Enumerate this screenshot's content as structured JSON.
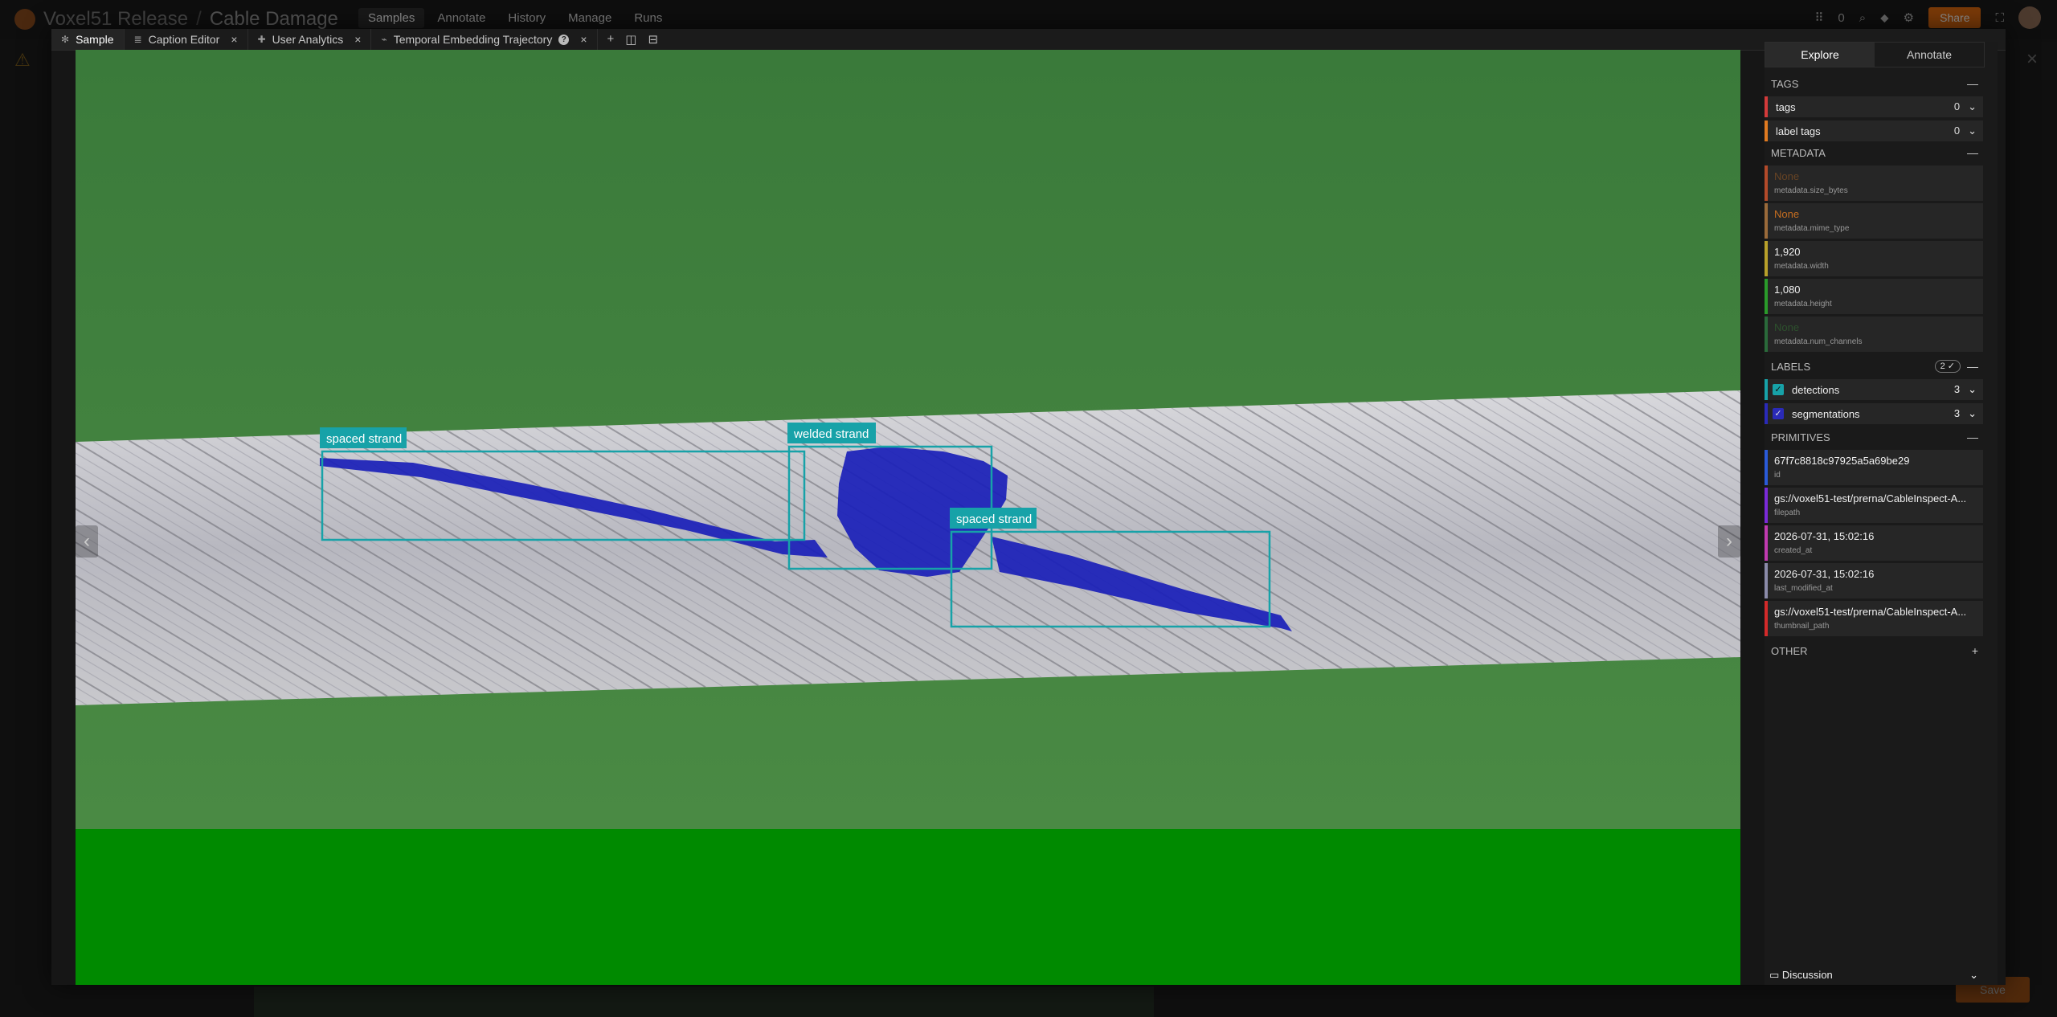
{
  "app": {
    "org": "Voxel51 Release",
    "dataset": "Cable Damage",
    "nav": [
      "Samples",
      "Annotate",
      "History",
      "Manage",
      "Runs"
    ],
    "active_nav": "Samples",
    "selected_count": "0",
    "share_label": "Share"
  },
  "modal": {
    "tabs": [
      {
        "label": "Sample",
        "closable": false,
        "active": true
      },
      {
        "label": "Caption Editor",
        "closable": true,
        "active": false
      },
      {
        "label": "User Analytics",
        "closable": true,
        "active": false
      },
      {
        "label": "Temporal Embedding Trajectory",
        "closable": true,
        "active": false,
        "help": true
      }
    ]
  },
  "viewer": {
    "detections": [
      {
        "label": "spaced strand",
        "color": "#17a2a8"
      },
      {
        "label": "welded strand",
        "color": "#17a2a8"
      },
      {
        "label": "spaced strand",
        "color": "#17a2a8"
      }
    ],
    "mask_color": "#1a20b8",
    "background_color": "#3d7f3d",
    "bottom_band_color": "#008a00"
  },
  "sidebar": {
    "tabs": [
      "Explore",
      "Annotate"
    ],
    "active_tab": "Explore",
    "tags_section": "TAGS",
    "tags": [
      {
        "label": "tags",
        "count": "0",
        "color": "#d33a3a"
      },
      {
        "label": "label tags",
        "count": "0",
        "color": "#e07a20"
      }
    ],
    "metadata_section": "METADATA",
    "metadata": [
      {
        "value": "None",
        "key": "metadata.size_bytes",
        "color": "#b34a2a",
        "style": "none-dim"
      },
      {
        "value": "None",
        "key": "metadata.mime_type",
        "color": "#9a6a3a",
        "style": "none"
      },
      {
        "value": "1,920",
        "key": "metadata.width",
        "color": "#b8a02a",
        "style": "value"
      },
      {
        "value": "1,080",
        "key": "metadata.height",
        "color": "#2a9a2a",
        "style": "value"
      },
      {
        "value": "None",
        "key": "metadata.num_channels",
        "color": "#2a6a3a",
        "style": "none-green"
      }
    ],
    "labels_section": "LABELS",
    "labels_badge": "2 ✓",
    "labels": [
      {
        "label": "detections",
        "count": "3",
        "color": "#17a2a8",
        "checked": true
      },
      {
        "label": "segmentations",
        "count": "3",
        "color": "#2a2ab8",
        "checked": true
      }
    ],
    "primitives_section": "PRIMITIVES",
    "primitives": [
      {
        "value": "67f7c8818c97925a5a69be29",
        "key": "id",
        "color": "#2a5ad8"
      },
      {
        "value": "gs://voxel51-test/prerna/CableInspect-A...",
        "key": "filepath",
        "color": "#7a2ad8"
      },
      {
        "value": "2026-07-31, 15:02:16",
        "key": "created_at",
        "color": "#c03ab0"
      },
      {
        "value": "2026-07-31, 15:02:16",
        "key": "last_modified_at",
        "color": "#8a8aa8"
      },
      {
        "value": "gs://voxel51-test/prerna/CableInspect-A...",
        "key": "thumbnail_path",
        "color": "#d32a2a"
      }
    ],
    "other_section": "OTHER",
    "discussion_label": "Discussion"
  }
}
